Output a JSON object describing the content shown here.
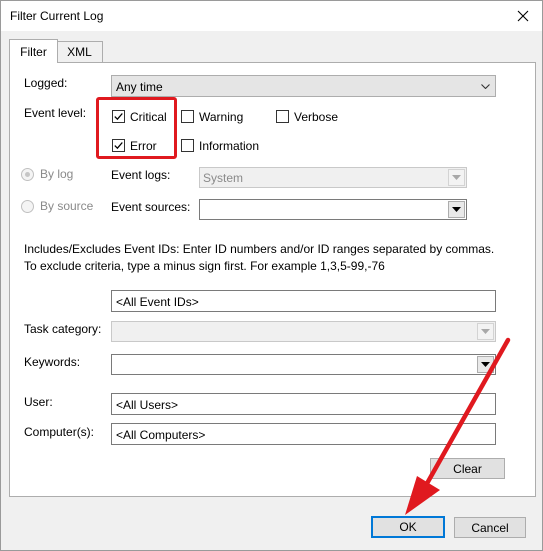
{
  "window": {
    "title": "Filter Current Log"
  },
  "tabs": {
    "filter": "Filter",
    "xml": "XML"
  },
  "logged": {
    "label": "Logged:",
    "value": "Any time"
  },
  "event_level": {
    "label": "Event level:",
    "critical": "Critical",
    "warning": "Warning",
    "verbose": "Verbose",
    "error": "Error",
    "information": "Information"
  },
  "by_log": {
    "label": "By log",
    "event_logs_label": "Event logs:",
    "event_logs_value": "System"
  },
  "by_source": {
    "label": "By source",
    "event_sources_label": "Event sources:"
  },
  "description": "Includes/Excludes Event IDs: Enter ID numbers and/or ID ranges separated by commas. To exclude criteria, type a minus sign first. For example 1,3,5-99,-76",
  "event_ids": {
    "value": "<All Event IDs>"
  },
  "task_category": {
    "label": "Task category:"
  },
  "keywords": {
    "label": "Keywords:"
  },
  "user": {
    "label": "User:",
    "value": "<All Users>"
  },
  "computer": {
    "label": "Computer(s):",
    "value": "<All Computers>"
  },
  "buttons": {
    "clear": "Clear",
    "ok": "OK",
    "cancel": "Cancel"
  },
  "colors": {
    "annotation_red": "#e0191f",
    "default_button_border": "#0078d7"
  }
}
